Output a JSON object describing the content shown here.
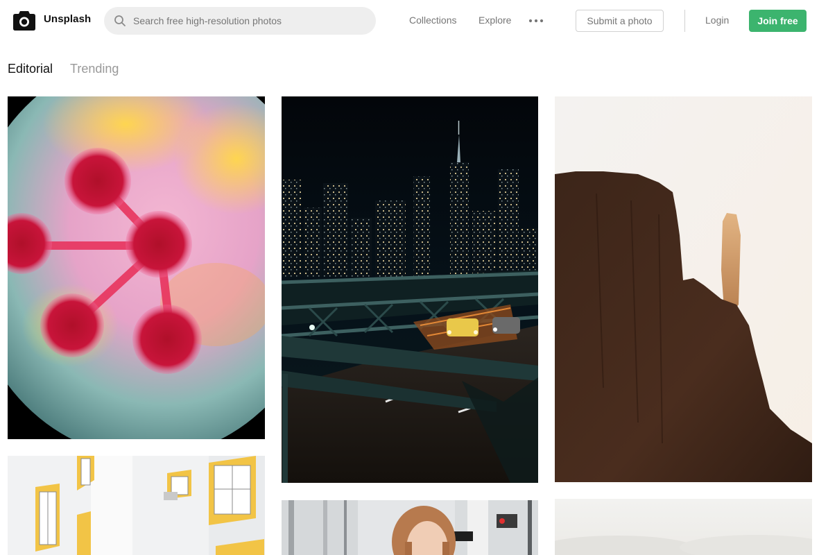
{
  "header": {
    "brand": "Unsplash",
    "logo_icon": "camera-icon",
    "search": {
      "placeholder": "Search free high-resolution photos",
      "value": "",
      "icon": "search-icon"
    },
    "nav": [
      {
        "label": "Collections"
      },
      {
        "label": "Explore"
      }
    ],
    "more_icon": "more-horizontal-icon",
    "submit_label": "Submit a photo",
    "login_label": "Login",
    "join_label": "Join free",
    "accent_color": "#3cb46e"
  },
  "tabs": [
    {
      "label": "Editorial",
      "active": true
    },
    {
      "label": "Trending",
      "active": false
    }
  ],
  "photos": [
    {
      "name": "photo-pink-flower",
      "column": 1,
      "subject": "pink-flower-closeup"
    },
    {
      "name": "photo-city-bridge-night",
      "column": 2,
      "subject": "city-skyline-bridge-night"
    },
    {
      "name": "photo-desert-butte",
      "column": 3,
      "subject": "desert-rock-formation"
    },
    {
      "name": "photo-white-building",
      "column": 1,
      "subject": "white-building-yellow-windows"
    },
    {
      "name": "photo-street-woman",
      "column": 2,
      "subject": "woman-on-street"
    },
    {
      "name": "photo-misty",
      "column": 3,
      "subject": "misty-landscape"
    }
  ]
}
